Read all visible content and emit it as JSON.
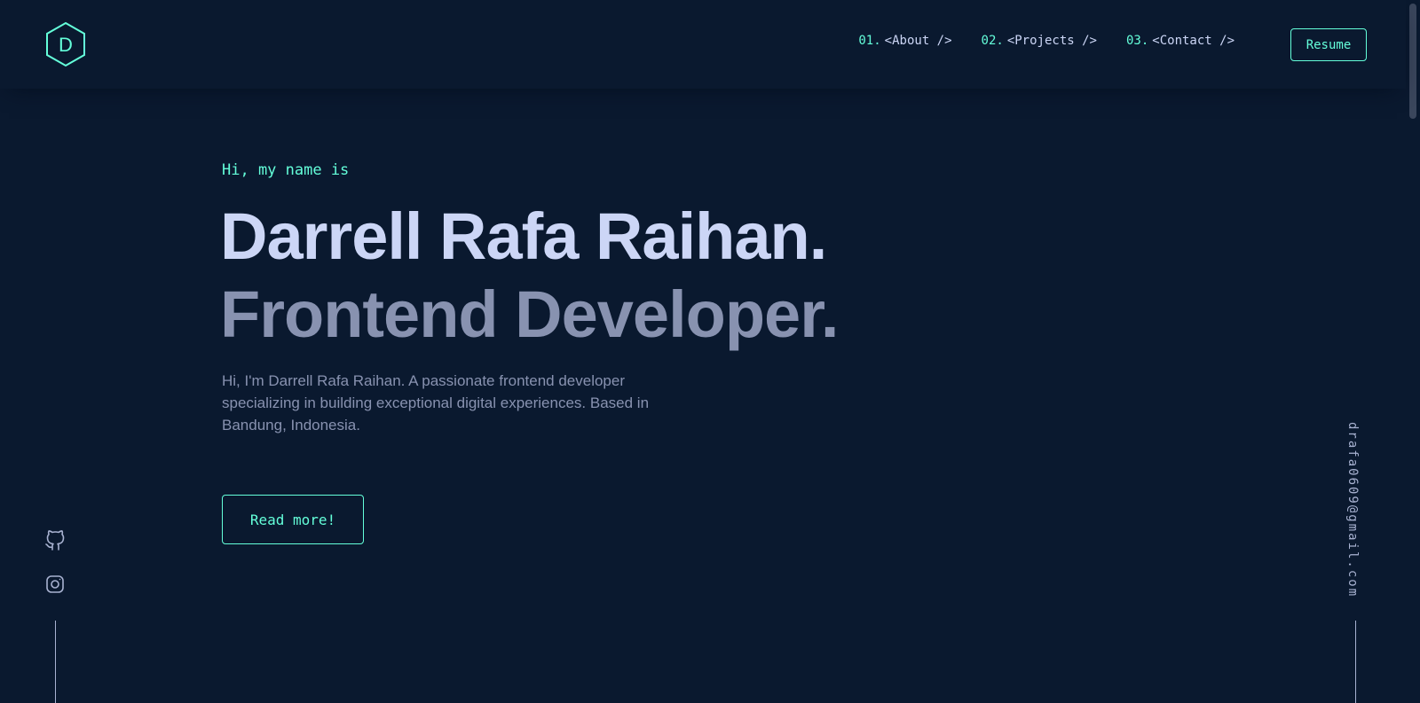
{
  "logo": {
    "letter": "D"
  },
  "nav": {
    "items": [
      {
        "num": "01.",
        "label": "<About />"
      },
      {
        "num": "02.",
        "label": "<Projects />"
      },
      {
        "num": "03.",
        "label": "<Contact />"
      }
    ],
    "resume_label": "Resume"
  },
  "hero": {
    "greeting": "Hi, my name is",
    "name": "Darrell Rafa Raihan.",
    "role": "Frontend Developer.",
    "bio": "Hi, I'm Darrell Rafa Raihan. A passionate frontend developer specializing in building exceptional digital experiences. Based in Bandung, Indonesia.",
    "button_label": "Read more!"
  },
  "social": {
    "icons": [
      "github-icon",
      "instagram-icon"
    ]
  },
  "email": "drafa0609@gmail.com",
  "colors": {
    "background": "#0a192f",
    "accent": "#64ffda",
    "heading": "#ccd6f6",
    "muted": "#8892b0"
  }
}
